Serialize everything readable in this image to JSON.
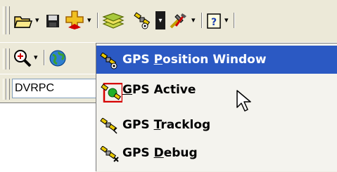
{
  "toolbar_row1": {
    "icons": [
      "open-folder-icon",
      "save-disk-icon",
      "add-layer-icon",
      "layers-icon",
      "gps-icon",
      "dropdown-arrow-icon",
      "tools-icon",
      "help-icon"
    ]
  },
  "toolbar_row2": {
    "icons": [
      "zoom-in-icon",
      "globe-icon"
    ]
  },
  "layer_combo": {
    "value": "DVRPC"
  },
  "menu": {
    "items": [
      {
        "pre": "GPS ",
        "key": "P",
        "post": "osition Window",
        "highlighted": true
      },
      {
        "pre": "",
        "key": "G",
        "post": "PS Active",
        "checked": true
      },
      {
        "pre": "GPS ",
        "key": "T",
        "post": "racklog"
      },
      {
        "pre": "GPS ",
        "key": "D",
        "post": "ebug"
      }
    ]
  },
  "colors": {
    "highlight": "#2b59c3",
    "toolbar": "#ece9d8",
    "menu_bg": "#f4f3ee",
    "check_frame": "#d60000"
  }
}
